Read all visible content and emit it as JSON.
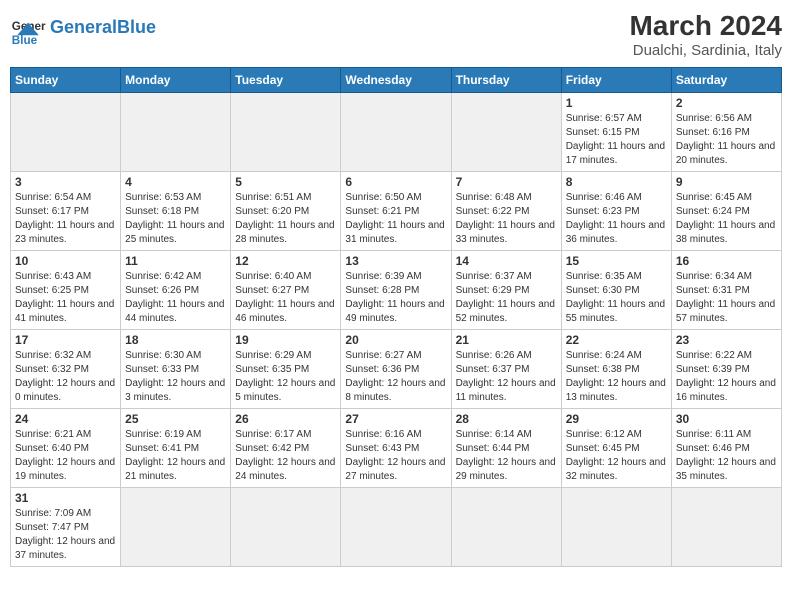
{
  "header": {
    "logo_general": "General",
    "logo_blue": "Blue",
    "month_title": "March 2024",
    "location": "Dualchi, Sardinia, Italy"
  },
  "weekdays": [
    "Sunday",
    "Monday",
    "Tuesday",
    "Wednesday",
    "Thursday",
    "Friday",
    "Saturday"
  ],
  "weeks": [
    [
      {
        "day": "",
        "info": ""
      },
      {
        "day": "",
        "info": ""
      },
      {
        "day": "",
        "info": ""
      },
      {
        "day": "",
        "info": ""
      },
      {
        "day": "",
        "info": ""
      },
      {
        "day": "1",
        "info": "Sunrise: 6:57 AM\nSunset: 6:15 PM\nDaylight: 11 hours\nand 17 minutes."
      },
      {
        "day": "2",
        "info": "Sunrise: 6:56 AM\nSunset: 6:16 PM\nDaylight: 11 hours\nand 20 minutes."
      }
    ],
    [
      {
        "day": "3",
        "info": "Sunrise: 6:54 AM\nSunset: 6:17 PM\nDaylight: 11 hours\nand 23 minutes."
      },
      {
        "day": "4",
        "info": "Sunrise: 6:53 AM\nSunset: 6:18 PM\nDaylight: 11 hours\nand 25 minutes."
      },
      {
        "day": "5",
        "info": "Sunrise: 6:51 AM\nSunset: 6:20 PM\nDaylight: 11 hours\nand 28 minutes."
      },
      {
        "day": "6",
        "info": "Sunrise: 6:50 AM\nSunset: 6:21 PM\nDaylight: 11 hours\nand 31 minutes."
      },
      {
        "day": "7",
        "info": "Sunrise: 6:48 AM\nSunset: 6:22 PM\nDaylight: 11 hours\nand 33 minutes."
      },
      {
        "day": "8",
        "info": "Sunrise: 6:46 AM\nSunset: 6:23 PM\nDaylight: 11 hours\nand 36 minutes."
      },
      {
        "day": "9",
        "info": "Sunrise: 6:45 AM\nSunset: 6:24 PM\nDaylight: 11 hours\nand 38 minutes."
      }
    ],
    [
      {
        "day": "10",
        "info": "Sunrise: 6:43 AM\nSunset: 6:25 PM\nDaylight: 11 hours\nand 41 minutes."
      },
      {
        "day": "11",
        "info": "Sunrise: 6:42 AM\nSunset: 6:26 PM\nDaylight: 11 hours\nand 44 minutes."
      },
      {
        "day": "12",
        "info": "Sunrise: 6:40 AM\nSunset: 6:27 PM\nDaylight: 11 hours\nand 46 minutes."
      },
      {
        "day": "13",
        "info": "Sunrise: 6:39 AM\nSunset: 6:28 PM\nDaylight: 11 hours\nand 49 minutes."
      },
      {
        "day": "14",
        "info": "Sunrise: 6:37 AM\nSunset: 6:29 PM\nDaylight: 11 hours\nand 52 minutes."
      },
      {
        "day": "15",
        "info": "Sunrise: 6:35 AM\nSunset: 6:30 PM\nDaylight: 11 hours\nand 55 minutes."
      },
      {
        "day": "16",
        "info": "Sunrise: 6:34 AM\nSunset: 6:31 PM\nDaylight: 11 hours\nand 57 minutes."
      }
    ],
    [
      {
        "day": "17",
        "info": "Sunrise: 6:32 AM\nSunset: 6:32 PM\nDaylight: 12 hours\nand 0 minutes."
      },
      {
        "day": "18",
        "info": "Sunrise: 6:30 AM\nSunset: 6:33 PM\nDaylight: 12 hours\nand 3 minutes."
      },
      {
        "day": "19",
        "info": "Sunrise: 6:29 AM\nSunset: 6:35 PM\nDaylight: 12 hours\nand 5 minutes."
      },
      {
        "day": "20",
        "info": "Sunrise: 6:27 AM\nSunset: 6:36 PM\nDaylight: 12 hours\nand 8 minutes."
      },
      {
        "day": "21",
        "info": "Sunrise: 6:26 AM\nSunset: 6:37 PM\nDaylight: 12 hours\nand 11 minutes."
      },
      {
        "day": "22",
        "info": "Sunrise: 6:24 AM\nSunset: 6:38 PM\nDaylight: 12 hours\nand 13 minutes."
      },
      {
        "day": "23",
        "info": "Sunrise: 6:22 AM\nSunset: 6:39 PM\nDaylight: 12 hours\nand 16 minutes."
      }
    ],
    [
      {
        "day": "24",
        "info": "Sunrise: 6:21 AM\nSunset: 6:40 PM\nDaylight: 12 hours\nand 19 minutes."
      },
      {
        "day": "25",
        "info": "Sunrise: 6:19 AM\nSunset: 6:41 PM\nDaylight: 12 hours\nand 21 minutes."
      },
      {
        "day": "26",
        "info": "Sunrise: 6:17 AM\nSunset: 6:42 PM\nDaylight: 12 hours\nand 24 minutes."
      },
      {
        "day": "27",
        "info": "Sunrise: 6:16 AM\nSunset: 6:43 PM\nDaylight: 12 hours\nand 27 minutes."
      },
      {
        "day": "28",
        "info": "Sunrise: 6:14 AM\nSunset: 6:44 PM\nDaylight: 12 hours\nand 29 minutes."
      },
      {
        "day": "29",
        "info": "Sunrise: 6:12 AM\nSunset: 6:45 PM\nDaylight: 12 hours\nand 32 minutes."
      },
      {
        "day": "30",
        "info": "Sunrise: 6:11 AM\nSunset: 6:46 PM\nDaylight: 12 hours\nand 35 minutes."
      }
    ],
    [
      {
        "day": "31",
        "info": "Sunrise: 7:09 AM\nSunset: 7:47 PM\nDaylight: 12 hours\nand 37 minutes."
      },
      {
        "day": "",
        "info": ""
      },
      {
        "day": "",
        "info": ""
      },
      {
        "day": "",
        "info": ""
      },
      {
        "day": "",
        "info": ""
      },
      {
        "day": "",
        "info": ""
      },
      {
        "day": "",
        "info": ""
      }
    ]
  ]
}
